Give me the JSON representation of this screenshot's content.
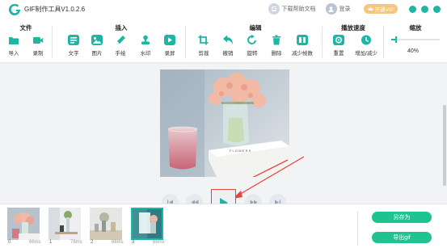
{
  "app": {
    "title": "GIF制作工具V1.0.2.6"
  },
  "titlebar": {
    "help_label": "下载帮助文档",
    "login_label": "登录",
    "vip_label": "开通VIP",
    "icons": [
      "help-doc-icon",
      "user-icon",
      "crown-icon",
      "minimize-icon",
      "maximize-icon",
      "close-icon"
    ]
  },
  "toolbar": {
    "groups": {
      "file": {
        "title": "文件",
        "items": [
          {
            "label": "导入",
            "icon": "import-folder-icon"
          },
          {
            "label": "录制",
            "icon": "record-video-icon"
          }
        ]
      },
      "insert": {
        "title": "插入",
        "items": [
          {
            "label": "文字",
            "icon": "text-icon"
          },
          {
            "label": "图片",
            "icon": "image-icon"
          },
          {
            "label": "手绘",
            "icon": "pencil-icon"
          },
          {
            "label": "水印",
            "icon": "watermark-stamp-icon"
          },
          {
            "label": "录屏",
            "icon": "screen-record-icon"
          }
        ]
      },
      "edit": {
        "title": "编辑",
        "items": [
          {
            "label": "剪裁",
            "icon": "crop-icon"
          },
          {
            "label": "撤销",
            "icon": "undo-icon"
          },
          {
            "label": "旋转",
            "icon": "rotate-icon"
          },
          {
            "label": "删除",
            "icon": "trash-icon"
          },
          {
            "label": "减少帧数",
            "icon": "reduce-frames-icon"
          }
        ]
      },
      "speed": {
        "title": "播放速度",
        "items": [
          {
            "label": "重置",
            "icon": "reset-icon"
          },
          {
            "label": "增加/减少",
            "icon": "speed-clock-icon"
          }
        ]
      },
      "zoom": {
        "title": "缩放",
        "value": "40%",
        "level": 0.08
      }
    }
  },
  "colors": {
    "accent": "#1db6a5",
    "green_button": "#1ec38f",
    "highlight_red": "#e8433a",
    "vip_gold": "#f6c680"
  },
  "playback": {
    "icons": [
      "first-frame-icon",
      "previous-frame-icon",
      "play-icon",
      "next-frame-icon",
      "last-frame-icon"
    ]
  },
  "frames": [
    {
      "index": "0",
      "duration": "66ms"
    },
    {
      "index": "1",
      "duration": "78ms"
    },
    {
      "index": "2",
      "duration": "66ms"
    },
    {
      "index": "3",
      "duration": "66ms",
      "selected": true
    }
  ],
  "actions": {
    "save_as_label": "另存为",
    "export_label": "导出gif"
  }
}
